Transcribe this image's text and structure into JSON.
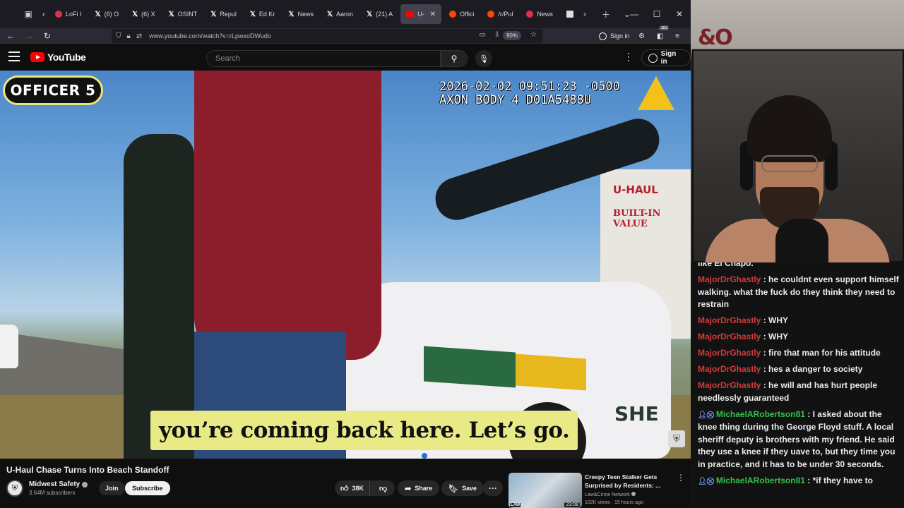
{
  "browser": {
    "tabs": [
      {
        "label": "LoFi I",
        "icon": "red-circle"
      },
      {
        "label": "(6) O",
        "icon": "x-logo"
      },
      {
        "label": "(6) X",
        "icon": "x-logo"
      },
      {
        "label": "OSINT",
        "icon": "x-logo"
      },
      {
        "label": "Repul",
        "icon": "x-logo"
      },
      {
        "label": "Ed Kr",
        "icon": "x-logo"
      },
      {
        "label": "News",
        "icon": "x-logo"
      },
      {
        "label": "Aaron",
        "icon": "x-logo"
      },
      {
        "label": "(21) A",
        "icon": "x-logo"
      },
      {
        "label": "U-",
        "icon": "youtube-logo",
        "active": true
      },
      {
        "label": "Offici",
        "icon": "reddit-logo"
      },
      {
        "label": "/r/Pul",
        "icon": "reddit-logo"
      },
      {
        "label": "News",
        "icon": "red-circle"
      }
    ],
    "url": "www.youtube.com/watch?v=rLpwxoDWudo",
    "zoom": "90%",
    "sign_in": "Sign in",
    "notification_count": "182"
  },
  "youtube": {
    "logo_text": "YouTube",
    "search_placeholder": "Search",
    "sign_in": "Sign in"
  },
  "video": {
    "officer_label": "OFFICER 5",
    "timestamp_line1": "2026-02-02 09:51:23 -0500",
    "timestamp_line2": "AXON BODY 4 D01A5488U",
    "caption": "you’re coming back here. Let’s go.",
    "scene_text_uhaul": "U-HAUL",
    "scene_text_builtin": "BUILT-IN VALUE",
    "scene_text_sheriff": "SHE"
  },
  "meta": {
    "title": "U-Haul Chase Turns Into Beach Standoff",
    "channel": "Midwest Safety",
    "subscribers": "3.64M subscribers",
    "join": "Join",
    "subscribe": "Subscribe",
    "likes": "38K",
    "share": "Share",
    "save": "Save"
  },
  "recommended": {
    "title": "Creepy Teen Stalker Gets Surprised by Residents: ...",
    "channel": "Law&Crime Network",
    "views": "102K views",
    "age": "15 hours ago",
    "duration": "23:08",
    "thumb_label": "LAW"
  },
  "webcam": {
    "sign_text": "&O"
  },
  "chat": [
    {
      "user": "",
      "text": "like El Chapo.",
      "user_color": "none",
      "badges": false,
      "cut": true
    },
    {
      "user": "MajorDrGhastly",
      "text": "he couldnt even support himself walking. what the fuck do they think they need to restrain",
      "user_color": "#d03b3b",
      "badges": false
    },
    {
      "user": "MajorDrGhastly",
      "text": "WHY",
      "user_color": "#d03b3b",
      "badges": false
    },
    {
      "user": "MajorDrGhastly",
      "text": "WHY",
      "user_color": "#d03b3b",
      "badges": false
    },
    {
      "user": "MajorDrGhastly",
      "text": "fire that man for his attitude",
      "user_color": "#d03b3b",
      "badges": false
    },
    {
      "user": "MajorDrGhastly",
      "text": "hes a danger to society",
      "user_color": "#d03b3b",
      "badges": false
    },
    {
      "user": "MajorDrGhastly",
      "text": "he will and has hurt people needlessly guaranteed",
      "user_color": "#d03b3b",
      "badges": false
    },
    {
      "user": "MichaelARobertson81",
      "text": "I asked about the knee thing during the George Floyd stuff. A local sheriff deputy is brothers with my friend. He said they use a knee if they uave to, but they time you in practice, and it has to be under 30 seconds.",
      "user_color": "#35c24a",
      "badges": true
    },
    {
      "user": "MichaelARobertson81",
      "text": "*if they have to",
      "user_color": "#35c24a",
      "badges": true
    }
  ]
}
